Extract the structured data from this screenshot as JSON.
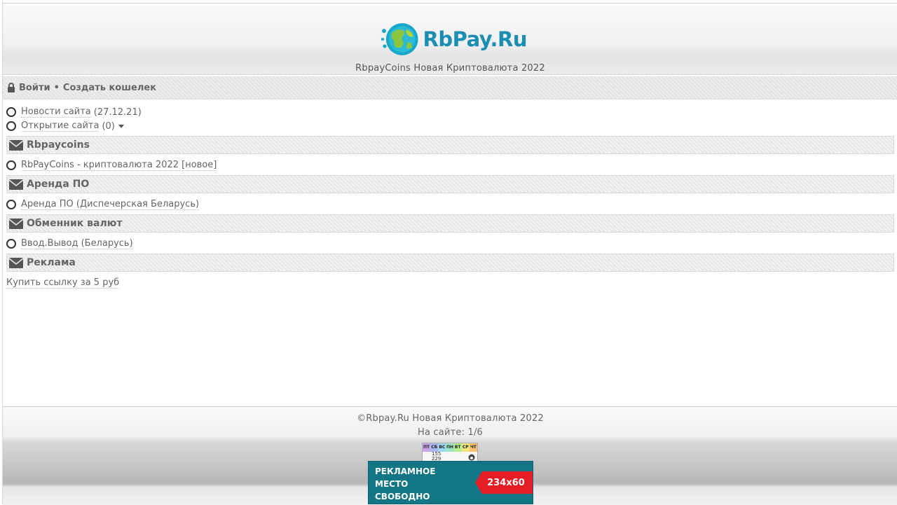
{
  "header": {
    "logo_text": "RbPay.Ru",
    "subtitle": "RbpayCoins Новая Криптовалюта 2022"
  },
  "auth": {
    "login": "Войти",
    "separator": "•",
    "create_wallet": "Создать кошелек"
  },
  "top_items": [
    {
      "label": "Новости сайта",
      "count": "(27.12.21)"
    },
    {
      "label": "Открытие сайта",
      "count": "(0)"
    }
  ],
  "sections": [
    {
      "title": "Rbpaycoins",
      "items": [
        {
          "label": "RbPayCoins - криптовалюта 2022 [новое]"
        }
      ]
    },
    {
      "title": "Аренда ПО",
      "items": [
        {
          "label": "Аренда ПО (Диспечерская Беларусь)"
        }
      ]
    },
    {
      "title": "Обменник валют",
      "items": [
        {
          "label": "Ввод.Вывод (Беларусь)"
        }
      ]
    },
    {
      "title": "Реклама",
      "link": "Купить ссылку за 5 руб"
    }
  ],
  "footer": {
    "copyright": "©Rbpay.Ru Новая Криптовалюта 2022",
    "online": "На сайте: 1/6",
    "counter": {
      "days": [
        "ПТ",
        "СБ",
        "ВС",
        "ПН",
        "ВТ",
        "СР",
        "ЧТ"
      ],
      "line1": "155",
      "line2": "229"
    },
    "banner": {
      "line1": "РЕКЛАМНОЕ",
      "line2": "МЕСТО",
      "line3": "СВОБОДНО",
      "size": "234x60"
    }
  },
  "colors": {
    "brand": "#1b8fb1",
    "banner_bg": "#137685",
    "banner_tag": "#e41d24"
  }
}
